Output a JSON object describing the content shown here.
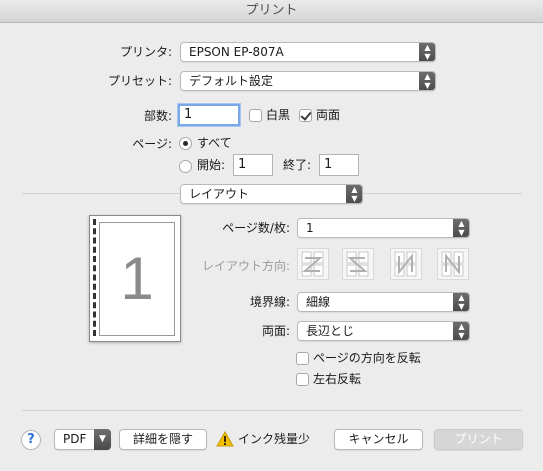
{
  "window": {
    "title": "プリント"
  },
  "printer": {
    "label": "プリンタ:",
    "value": "EPSON EP-807A"
  },
  "preset": {
    "label": "プリセット:",
    "value": "デフォルト設定"
  },
  "copies": {
    "label": "部数:",
    "value": "1",
    "bw_label": "白黒",
    "bw_checked": false,
    "duplex_label": "両面",
    "duplex_checked": true
  },
  "pages": {
    "label": "ページ:",
    "all_label": "すべて",
    "range_label": "開始:",
    "from_value": "1",
    "to_label": "終了:",
    "to_value": "1"
  },
  "section": {
    "value": "レイアウト"
  },
  "preview": {
    "page_number": "1"
  },
  "layout": {
    "pages_per_sheet_label": "ページ数/枚:",
    "pages_per_sheet_value": "1",
    "direction_label": "レイアウト方向:",
    "border_label": "境界線:",
    "border_value": "細線",
    "duplex_label": "両面:",
    "duplex_value": "長辺とじ",
    "reverse_label": "ページの方向を反転",
    "flip_label": "左右反転"
  },
  "footer": {
    "help": "?",
    "pdf": "PDF",
    "hide_details": "詳細を隠す",
    "warning": "インク残量少",
    "cancel": "キャンセル",
    "print": "プリント"
  },
  "icons": {
    "popup_arrows": "updown-chevron-icon",
    "warning": "warning-triangle-icon",
    "chevron": "chevron-down-icon"
  }
}
